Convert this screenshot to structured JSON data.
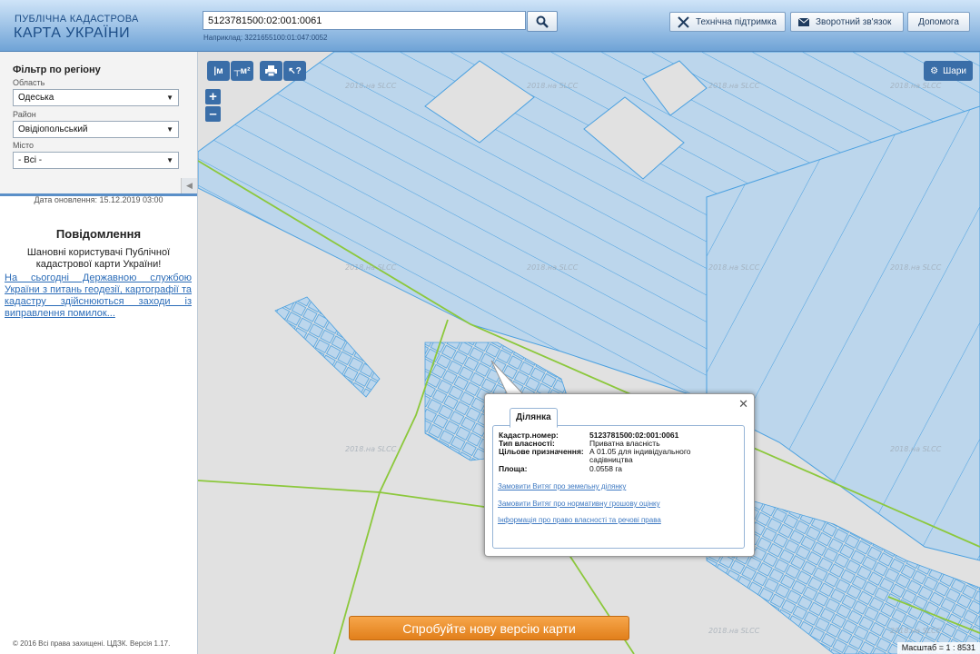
{
  "header": {
    "logo_line1": "ПУБЛІЧНА КАДАСТРОВА",
    "logo_line2": "КАРТА УКРАЇНИ",
    "search_value": "5123781500:02:001:0061",
    "search_hint": "Наприклад: 3221655100:01:047:0052",
    "buttons": {
      "support": "Технічна підтримка",
      "feedback": "Зворотний зв'язок",
      "help": "Допомога"
    }
  },
  "sidebar": {
    "filter_title": "Фільтр по регіону",
    "region_label": "Область",
    "region_value": "Одеська",
    "district_label": "Район",
    "district_value": "Овідіопольський",
    "city_label": "Місто",
    "city_value": "- Всі -",
    "update_date": "Дата оновлення: 15.12.2019 03:00",
    "notice_title": "Повідомлення",
    "notice_text": "Шановні користувачі Публічної кадастрової карти України!",
    "notice_link": "На сьогодні Державною службою України з питань геодезії, картографії та кадастру здійснюються заходи із виправлення помилок...",
    "copyright": "© 2016 Всі права захищені. ЦДЗК. Версія 1.17."
  },
  "map": {
    "layers_button": "Шари",
    "watermark": "2018.на SLCC",
    "scale": "Масштаб = 1 : 8531",
    "banner": "Спробуйте нову версію карти",
    "colors": {
      "parcel_fill": "#bcd6ec",
      "parcel_stroke": "#4aa0e0",
      "road_line": "#8cc83c",
      "map_background": "#e1e1e1"
    }
  },
  "popup": {
    "tab": "Ділянка",
    "rows": [
      {
        "key": "Кадастр.номер:",
        "value": "5123781500:02:001:0061"
      },
      {
        "key": "Тип власності:",
        "value": "Приватна власність"
      },
      {
        "key": "Цільове призначення:",
        "value": "А 01.05 для індивідуального садівництва"
      },
      {
        "key": "Площа:",
        "value": "0.0558 га"
      }
    ],
    "links": [
      "Замовити Витяг про земельну ділянку",
      "Замовити Витяг про нормативну грошову оцінку",
      "Інформація про право власності та речові права"
    ]
  }
}
